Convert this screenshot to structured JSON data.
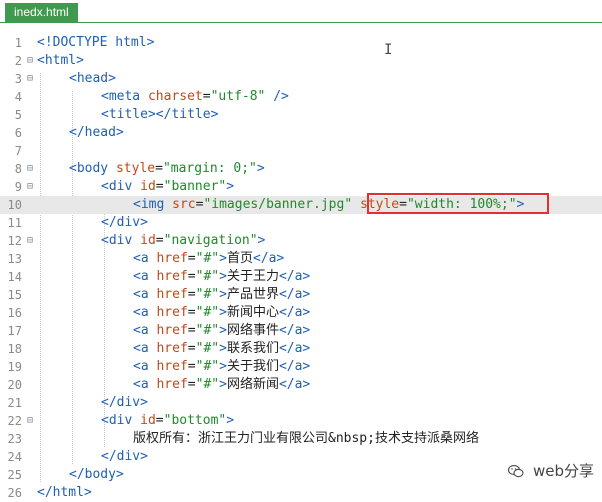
{
  "tab": {
    "title": "inedx.html"
  },
  "watermark": {
    "text": "web分享"
  },
  "highlight_line": 10,
  "colors": {
    "tag": "#1f5fb5",
    "attr": "#c04a18",
    "string": "#1f8a2a",
    "highlight_box": "#e03030",
    "tab_bg": "#3f9a4f"
  },
  "lines": [
    {
      "n": "1",
      "fold": "",
      "indent": 0,
      "tokens": [
        [
          "tag",
          "<!DOCTYPE html>"
        ]
      ]
    },
    {
      "n": "2",
      "fold": "⊟",
      "indent": 0,
      "tokens": [
        [
          "tag",
          "<html>"
        ]
      ]
    },
    {
      "n": "3",
      "fold": "⊟",
      "indent": 1,
      "tokens": [
        [
          "tag",
          "<head>"
        ]
      ]
    },
    {
      "n": "4",
      "fold": "",
      "indent": 2,
      "tokens": [
        [
          "tag",
          "<meta "
        ],
        [
          "attr",
          "charset"
        ],
        [
          "txt",
          "="
        ],
        [
          "str",
          "\"utf-8\""
        ],
        [
          "tag",
          " />"
        ]
      ]
    },
    {
      "n": "5",
      "fold": "",
      "indent": 2,
      "tokens": [
        [
          "tag",
          "<title></title>"
        ]
      ]
    },
    {
      "n": "6",
      "fold": "",
      "indent": 1,
      "tokens": [
        [
          "tag",
          "</head>"
        ]
      ]
    },
    {
      "n": "7",
      "fold": "",
      "indent": 0,
      "tokens": []
    },
    {
      "n": "8",
      "fold": "⊟",
      "indent": 1,
      "tokens": [
        [
          "tag",
          "<body "
        ],
        [
          "attr",
          "style"
        ],
        [
          "txt",
          "="
        ],
        [
          "str",
          "\"margin: 0;\""
        ],
        [
          "tag",
          ">"
        ]
      ]
    },
    {
      "n": "9",
      "fold": "⊟",
      "indent": 2,
      "tokens": [
        [
          "tag",
          "<div "
        ],
        [
          "attr",
          "id"
        ],
        [
          "txt",
          "="
        ],
        [
          "str",
          "\"banner\""
        ],
        [
          "tag",
          ">"
        ]
      ]
    },
    {
      "n": "10",
      "fold": "",
      "indent": 3,
      "tokens": [
        [
          "tag",
          "<img "
        ],
        [
          "attr",
          "src"
        ],
        [
          "txt",
          "="
        ],
        [
          "str",
          "\"images/banner.jpg\""
        ],
        [
          "txt",
          " "
        ],
        [
          "attr",
          "style"
        ],
        [
          "txt",
          "="
        ],
        [
          "str",
          "\"width: 100%;\""
        ],
        [
          "tag",
          ">"
        ]
      ]
    },
    {
      "n": "11",
      "fold": "",
      "indent": 2,
      "tokens": [
        [
          "tag",
          "</div>"
        ]
      ]
    },
    {
      "n": "12",
      "fold": "⊟",
      "indent": 2,
      "tokens": [
        [
          "tag",
          "<div "
        ],
        [
          "attr",
          "id"
        ],
        [
          "txt",
          "="
        ],
        [
          "str",
          "\"navigation\""
        ],
        [
          "tag",
          ">"
        ]
      ]
    },
    {
      "n": "13",
      "fold": "",
      "indent": 3,
      "tokens": [
        [
          "tag",
          "<a "
        ],
        [
          "attr",
          "href"
        ],
        [
          "txt",
          "="
        ],
        [
          "str",
          "\"#\""
        ],
        [
          "tag",
          ">"
        ],
        [
          "txt",
          "首页"
        ],
        [
          "tag",
          "</a>"
        ]
      ]
    },
    {
      "n": "14",
      "fold": "",
      "indent": 3,
      "tokens": [
        [
          "tag",
          "<a "
        ],
        [
          "attr",
          "href"
        ],
        [
          "txt",
          "="
        ],
        [
          "str",
          "\"#\""
        ],
        [
          "tag",
          ">"
        ],
        [
          "txt",
          "关于王力"
        ],
        [
          "tag",
          "</a>"
        ]
      ]
    },
    {
      "n": "15",
      "fold": "",
      "indent": 3,
      "tokens": [
        [
          "tag",
          "<a "
        ],
        [
          "attr",
          "href"
        ],
        [
          "txt",
          "="
        ],
        [
          "str",
          "\"#\""
        ],
        [
          "tag",
          ">"
        ],
        [
          "txt",
          "产品世界"
        ],
        [
          "tag",
          "</a>"
        ]
      ]
    },
    {
      "n": "16",
      "fold": "",
      "indent": 3,
      "tokens": [
        [
          "tag",
          "<a "
        ],
        [
          "attr",
          "href"
        ],
        [
          "txt",
          "="
        ],
        [
          "str",
          "\"#\""
        ],
        [
          "tag",
          ">"
        ],
        [
          "txt",
          "新闻中心"
        ],
        [
          "tag",
          "</a>"
        ]
      ]
    },
    {
      "n": "17",
      "fold": "",
      "indent": 3,
      "tokens": [
        [
          "tag",
          "<a "
        ],
        [
          "attr",
          "href"
        ],
        [
          "txt",
          "="
        ],
        [
          "str",
          "\"#\""
        ],
        [
          "tag",
          ">"
        ],
        [
          "txt",
          "网络事件"
        ],
        [
          "tag",
          "</a>"
        ]
      ]
    },
    {
      "n": "18",
      "fold": "",
      "indent": 3,
      "tokens": [
        [
          "tag",
          "<a "
        ],
        [
          "attr",
          "href"
        ],
        [
          "txt",
          "="
        ],
        [
          "str",
          "\"#\""
        ],
        [
          "tag",
          ">"
        ],
        [
          "txt",
          "联系我们"
        ],
        [
          "tag",
          "</a>"
        ]
      ]
    },
    {
      "n": "19",
      "fold": "",
      "indent": 3,
      "tokens": [
        [
          "tag",
          "<a "
        ],
        [
          "attr",
          "href"
        ],
        [
          "txt",
          "="
        ],
        [
          "str",
          "\"#\""
        ],
        [
          "tag",
          ">"
        ],
        [
          "txt",
          "关于我们"
        ],
        [
          "tag",
          "</a>"
        ]
      ]
    },
    {
      "n": "20",
      "fold": "",
      "indent": 3,
      "tokens": [
        [
          "tag",
          "<a "
        ],
        [
          "attr",
          "href"
        ],
        [
          "txt",
          "="
        ],
        [
          "str",
          "\"#\""
        ],
        [
          "tag",
          ">"
        ],
        [
          "txt",
          "网络新闻"
        ],
        [
          "tag",
          "</a>"
        ]
      ]
    },
    {
      "n": "21",
      "fold": "",
      "indent": 2,
      "tokens": [
        [
          "tag",
          "</div>"
        ]
      ]
    },
    {
      "n": "22",
      "fold": "⊟",
      "indent": 2,
      "tokens": [
        [
          "tag",
          "<div "
        ],
        [
          "attr",
          "id"
        ],
        [
          "txt",
          "="
        ],
        [
          "str",
          "\"bottom\""
        ],
        [
          "tag",
          ">"
        ]
      ]
    },
    {
      "n": "23",
      "fold": "",
      "indent": 3,
      "tokens": [
        [
          "txt",
          "版权所有：浙江王力门业有限公司&nbsp;技术支持派桑网络"
        ]
      ]
    },
    {
      "n": "24",
      "fold": "",
      "indent": 2,
      "tokens": [
        [
          "tag",
          "</div>"
        ]
      ]
    },
    {
      "n": "25",
      "fold": "",
      "indent": 1,
      "tokens": [
        [
          "tag",
          "</body>"
        ]
      ]
    },
    {
      "n": "26",
      "fold": "",
      "indent": 0,
      "tokens": [
        [
          "tag",
          "</html>"
        ]
      ]
    }
  ]
}
